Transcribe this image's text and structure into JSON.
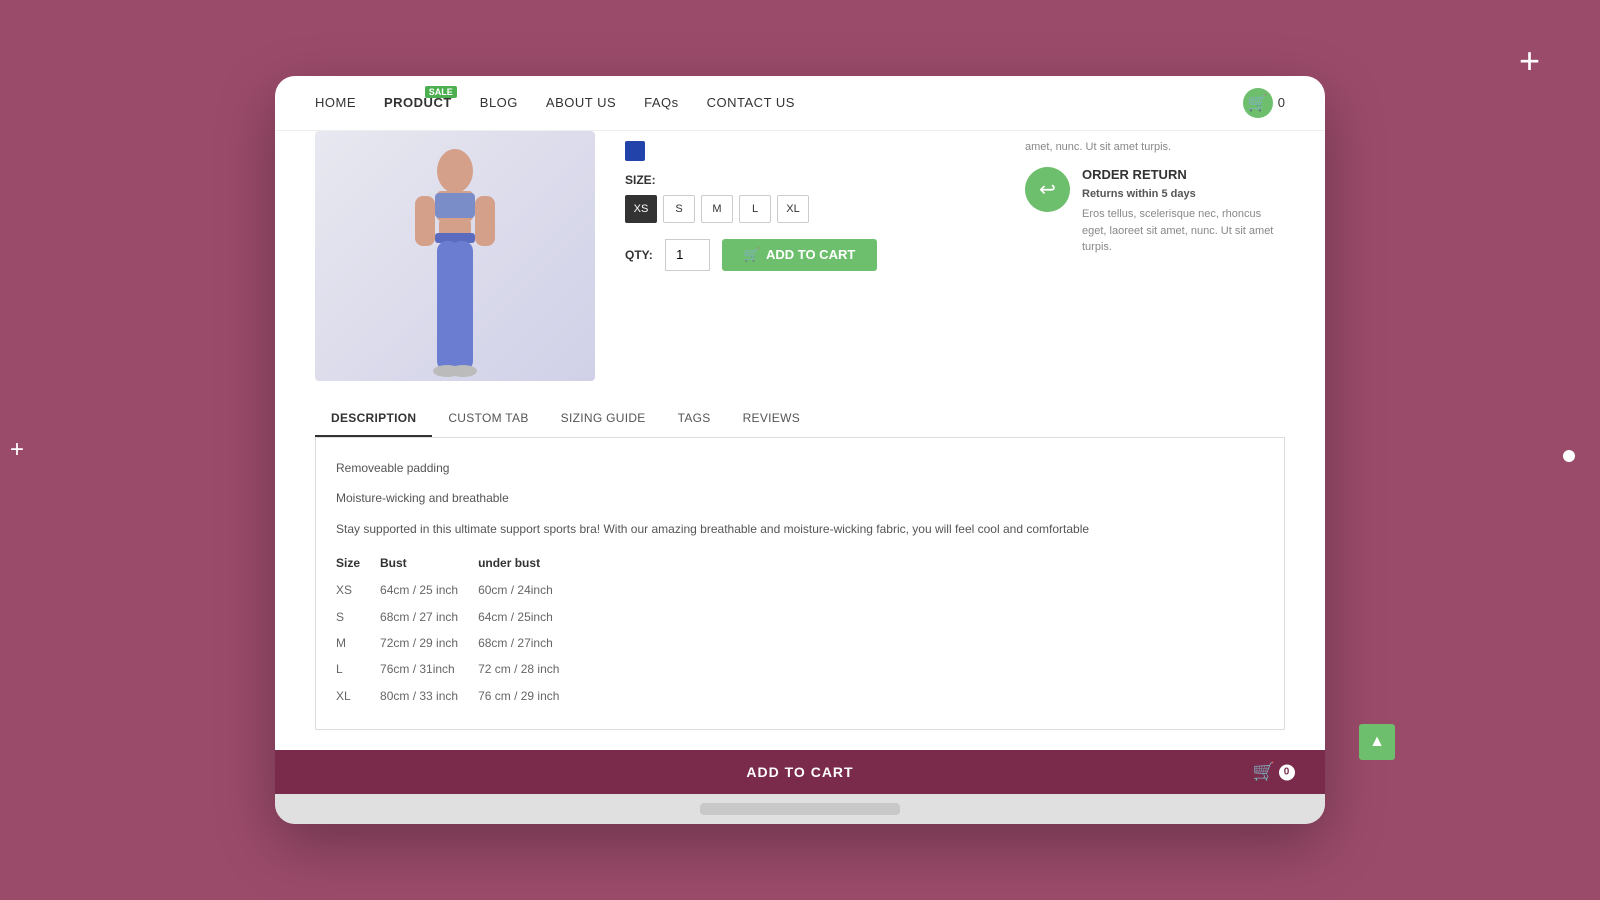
{
  "page": {
    "background_color": "#9b4b6a"
  },
  "navbar": {
    "links": [
      {
        "id": "home",
        "label": "HOME",
        "active": false,
        "sale": false
      },
      {
        "id": "product",
        "label": "PRODUCT",
        "active": true,
        "sale": true,
        "sale_label": "SALE"
      },
      {
        "id": "blog",
        "label": "BLOG",
        "active": false,
        "sale": false
      },
      {
        "id": "about",
        "label": "ABOUT US",
        "active": false,
        "sale": false
      },
      {
        "id": "faqs",
        "label": "FAQs",
        "active": false,
        "sale": false
      },
      {
        "id": "contact",
        "label": "CONTACT US",
        "active": false,
        "sale": false
      }
    ],
    "cart": {
      "count": "0"
    }
  },
  "product": {
    "colors": [
      {
        "hex": "#2244aa",
        "label": "blue"
      }
    ],
    "size_label": "SIZE:",
    "sizes": [
      "XS",
      "S",
      "M",
      "L",
      "XL"
    ],
    "selected_size": "XS",
    "qty_label": "QTY:",
    "qty_value": "1",
    "add_to_cart_label": "ADD TO CART"
  },
  "order_return": {
    "title": "ORDER RETURN",
    "subtitle": "Returns within 5 days",
    "description": "Eros tellus, scelerisque nec, rhoncus eget, laoreet sit amet, nunc. Ut sit amet turpis."
  },
  "sidebar_text": "amet, nunc. Ut sit amet turpis.",
  "tabs": [
    {
      "id": "description",
      "label": "DESCRIPTION",
      "active": true
    },
    {
      "id": "custom-tab",
      "label": "CUSTOM TAB",
      "active": false
    },
    {
      "id": "sizing-guide",
      "label": "SIZING GUIDE",
      "active": false
    },
    {
      "id": "tags",
      "label": "TAGS",
      "active": false
    },
    {
      "id": "reviews",
      "label": "REVIEWS",
      "active": false
    }
  ],
  "description": {
    "lines": [
      "Removeable padding",
      "Moisture-wicking and breathable",
      "Stay supported in this ultimate support sports bra! With our amazing breathable and moisture-wicking fabric, you will feel cool and comfortable"
    ],
    "table": {
      "headers": [
        "Size",
        "Bust",
        "under bust"
      ],
      "rows": [
        {
          "size": "XS",
          "bust": "64cm / 25 inch",
          "under_bust": "60cm / 24inch"
        },
        {
          "size": "S",
          "bust": "68cm / 27 inch",
          "under_bust": "64cm / 25inch"
        },
        {
          "size": "M",
          "bust": "72cm / 29 inch",
          "under_bust": "68cm / 27inch"
        },
        {
          "size": "L",
          "bust": "76cm / 31inch",
          "under_bust": "72 cm / 28 inch"
        },
        {
          "size": "XL",
          "bust": "80cm / 33 inch",
          "under_bust": "76 cm / 29 inch"
        }
      ]
    }
  },
  "sticky_bar": {
    "label": "ADD TO CART",
    "cart_count": "0"
  }
}
